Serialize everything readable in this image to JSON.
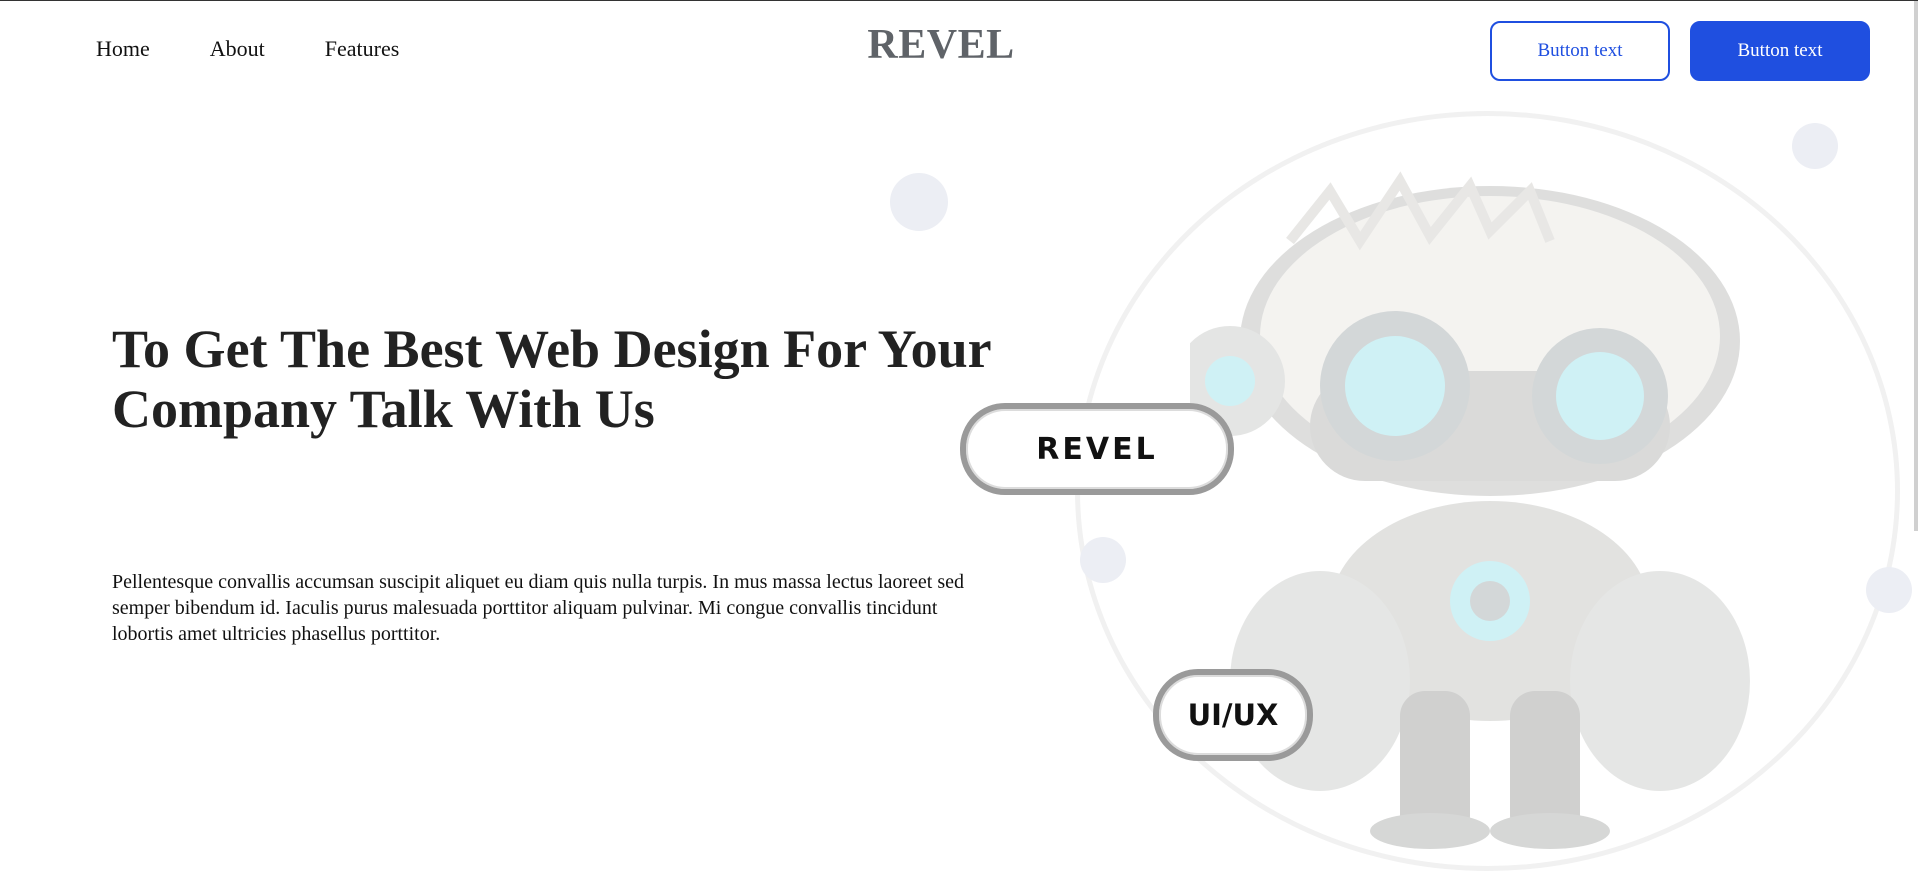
{
  "nav": {
    "items": [
      {
        "label": "Home"
      },
      {
        "label": "About"
      },
      {
        "label": "Features"
      }
    ]
  },
  "brand": {
    "name": "REVEL"
  },
  "header": {
    "buttons": [
      {
        "label": "Button text",
        "style": "outline"
      },
      {
        "label": "Button text",
        "style": "solid"
      }
    ]
  },
  "hero": {
    "title": "To Get The Best Web Design For Your Company Talk With Us",
    "body": "Pellentesque convallis accumsan suscipit aliquet eu diam quis nulla turpis. In mus massa lectus laoreet sed semper bibendum id. Iaculis purus malesuada porttitor aliquam pulvinar. Mi congue convallis tincidunt lobortis amet ultricies phasellus porttitor."
  },
  "badges": {
    "brand_badge": "REVEL",
    "skill_badge": "UI/UX"
  },
  "colors": {
    "accent": "#1f4fe0",
    "logo": "#5f6368",
    "text": "#222222"
  },
  "icons": {
    "hero_illustration": "robot-illustration"
  }
}
